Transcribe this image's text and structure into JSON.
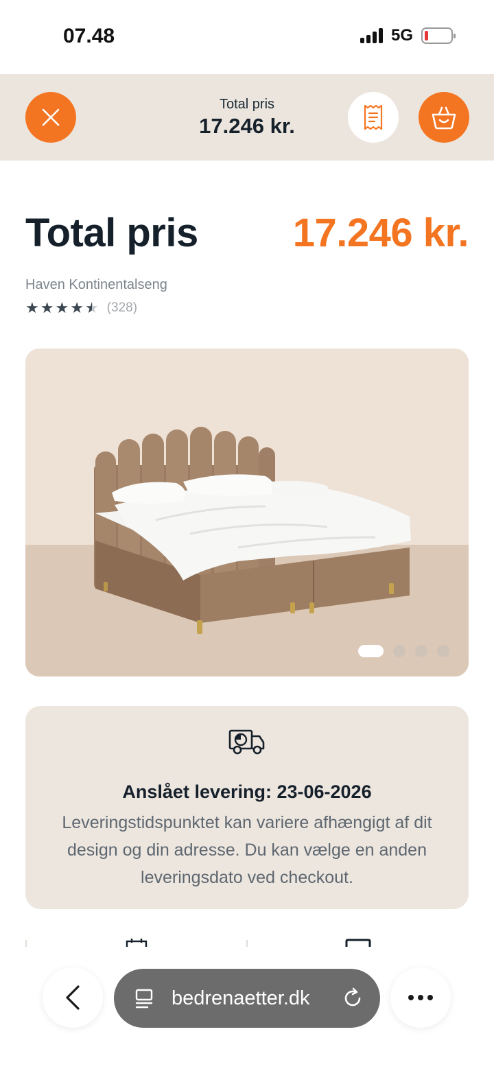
{
  "status_bar": {
    "time": "07.48",
    "network": "5G",
    "icons": [
      "signal-icon",
      "battery-icon"
    ]
  },
  "summary_bar": {
    "label": "Total pris",
    "price": "17.246 kr.",
    "icons": [
      "close-icon",
      "receipt-icon",
      "basket-icon"
    ]
  },
  "product": {
    "title": "Total pris",
    "price": "17.246 kr.",
    "name": "Haven Kontinentalseng",
    "rating": 4.5,
    "review_count": "(328)"
  },
  "gallery": {
    "image_count": 4,
    "active_index": 0
  },
  "delivery": {
    "icon": "delivery-truck-icon",
    "title": "Anslået levering: 23-06-2026",
    "description": "Leveringstidspunktet kan variere afhængigt af dit design og din adresse. Du kan vælge en anden leveringsdato ved checkout."
  },
  "browser": {
    "url": "bedrenaetter.dk",
    "icons": [
      "back-arrow-icon",
      "tabs-icon",
      "reload-icon",
      "more-icon"
    ]
  },
  "colors": {
    "accent": "#f47521",
    "header_bg": "#ece5dd",
    "card_bg": "#ede6df",
    "text": "#15202b"
  }
}
